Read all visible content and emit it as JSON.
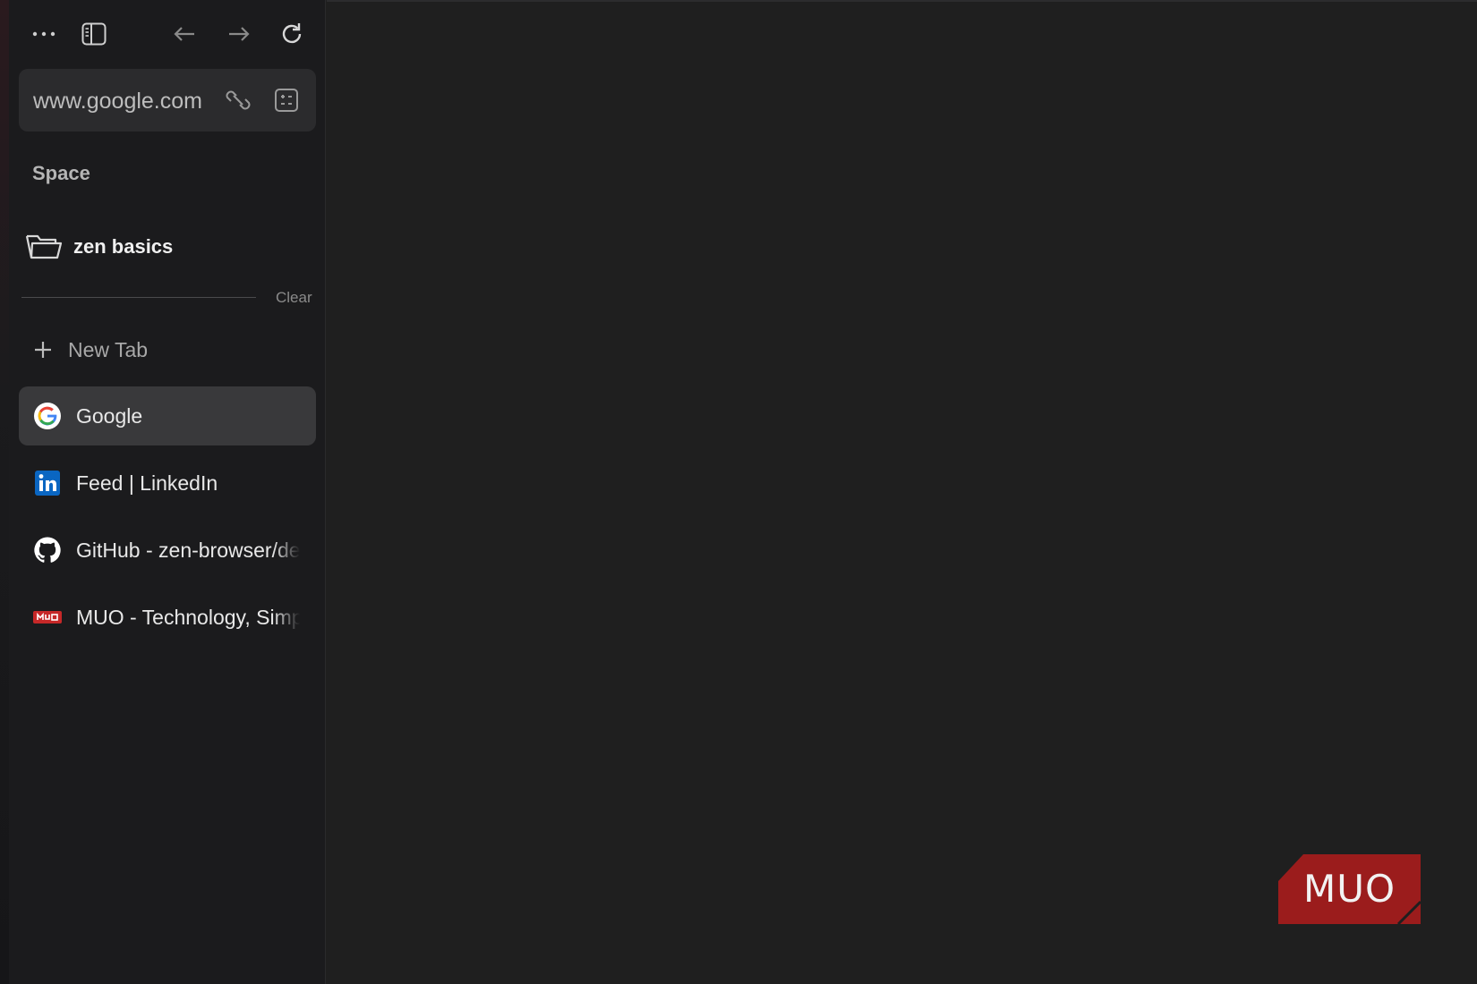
{
  "toolbar": {
    "menu_icon": "more-horizontal-icon",
    "sidebar_icon": "sidebar-toggle-icon",
    "back_icon": "arrow-left-icon",
    "forward_icon": "arrow-right-icon",
    "reload_icon": "reload-icon"
  },
  "urlbar": {
    "url": "www.google.com",
    "copy_icon": "link-icon",
    "page_actions_icon": "page-actions-icon"
  },
  "sidebar": {
    "space_label": "Space",
    "folder": {
      "label": "zen basics",
      "icon": "folder-icon"
    },
    "clear_label": "Clear",
    "new_tab_label": "New Tab",
    "tabs": [
      {
        "title": "Google",
        "icon": "google-icon",
        "active": true
      },
      {
        "title": "Feed | LinkedIn",
        "icon": "linkedin-icon",
        "active": false
      },
      {
        "title": "GitHub - zen-browser/desktop",
        "icon": "github-icon",
        "active": false
      },
      {
        "title": "MUO - Technology, Simplified.",
        "icon": "muo-icon",
        "active": false
      }
    ]
  },
  "watermark": {
    "text": "MUO",
    "color": "#9b1c1c"
  },
  "colors": {
    "sidebar_bg": "#1b1b1d",
    "content_bg": "#1f1f1f",
    "active_tab_bg": "#39393b",
    "urlbar_bg": "#2b2b2d"
  }
}
